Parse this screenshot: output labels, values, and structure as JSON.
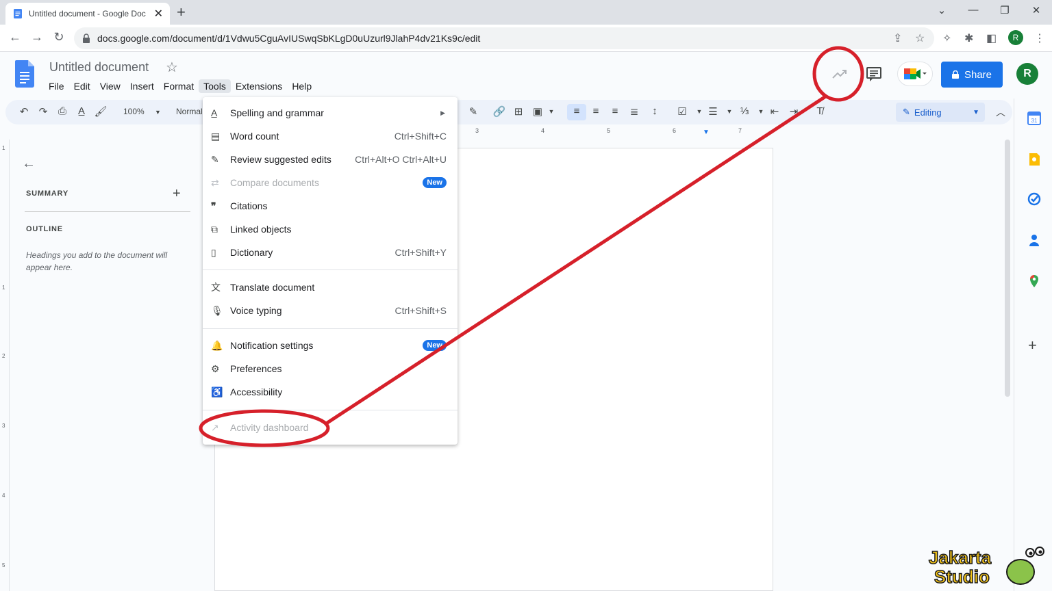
{
  "browser": {
    "tab_title": "Untitled document - Google Doc",
    "url": "docs.google.com/document/d/1Vdwu5CguAvIUSwqSbKLgD0uUzurl9JlahP4dv21Ks9c/edit",
    "profile_initial": "R"
  },
  "doc": {
    "title": "Untitled document",
    "menus": [
      "File",
      "Edit",
      "View",
      "Insert",
      "Format",
      "Tools",
      "Extensions",
      "Help"
    ],
    "active_menu": "Tools",
    "share_label": "Share",
    "avatar_initial": "R"
  },
  "toolbar": {
    "zoom": "100%",
    "style": "Normal",
    "editing_label": "Editing"
  },
  "ruler": {
    "h_ticks": [
      "3",
      "4",
      "5",
      "6",
      "7"
    ],
    "v_ticks": [
      "1",
      "1",
      "2",
      "3",
      "4",
      "5"
    ]
  },
  "side_panel": {
    "summary_label": "SUMMARY",
    "outline_label": "OUTLINE",
    "outline_hint": "Headings you add to the document will appear here."
  },
  "tools_menu": {
    "items": [
      {
        "label": "Spelling and grammar",
        "icon": "spellcheck-icon",
        "submenu": true
      },
      {
        "label": "Word count",
        "icon": "word-count-icon",
        "shortcut": "Ctrl+Shift+C"
      },
      {
        "label": "Review suggested edits",
        "icon": "review-edits-icon",
        "shortcut": "Ctrl+Alt+O Ctrl+Alt+U"
      },
      {
        "label": "Compare documents",
        "icon": "compare-icon",
        "badge": "New",
        "disabled": true
      },
      {
        "label": "Citations",
        "icon": "quote-icon"
      },
      {
        "label": "Linked objects",
        "icon": "linked-objects-icon"
      },
      {
        "label": "Dictionary",
        "icon": "dictionary-icon",
        "shortcut": "Ctrl+Shift+Y"
      },
      {
        "label": "Translate document",
        "icon": "translate-icon"
      },
      {
        "label": "Voice typing",
        "icon": "microphone-icon",
        "shortcut": "Ctrl+Shift+S"
      },
      {
        "label": "Notification settings",
        "icon": "bell-icon",
        "badge": "New"
      },
      {
        "label": "Preferences",
        "icon": "preferences-icon"
      },
      {
        "label": "Accessibility",
        "icon": "accessibility-icon"
      },
      {
        "label": "Activity dashboard",
        "icon": "trending-icon",
        "disabled": true
      }
    ]
  },
  "annotation_color": "#d6202a",
  "watermark": {
    "line1": "Jakarta",
    "line2": "Studio"
  }
}
